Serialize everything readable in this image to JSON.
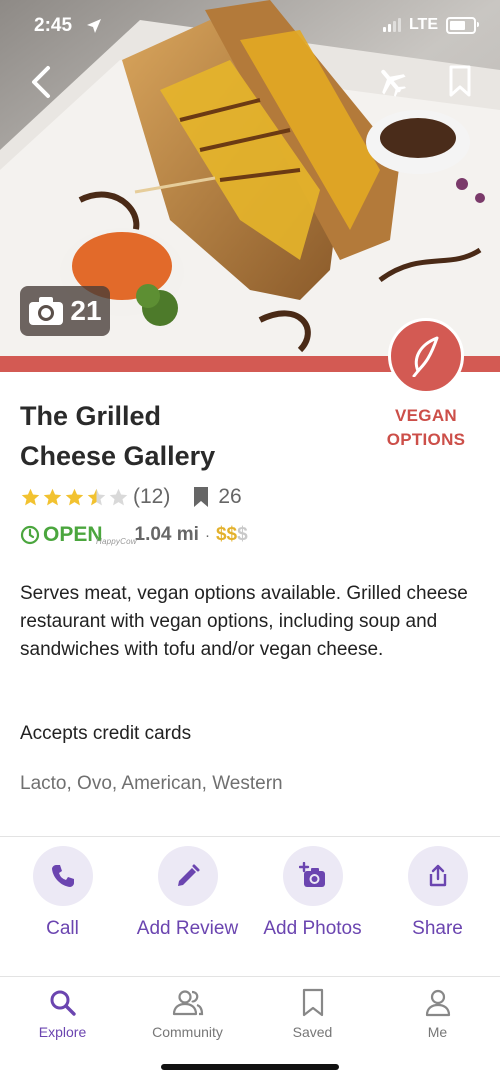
{
  "status_bar": {
    "time": "2:45",
    "network": "LTE"
  },
  "hero": {
    "photo_count": "21",
    "badge_icon": "leaf-icon"
  },
  "restaurant": {
    "name_line1": "The Grilled",
    "name_line2": "Cheese Gallery",
    "category_line1": "VEGAN",
    "category_line2": "OPTIONS",
    "rating": 3.5,
    "rating_max": 5,
    "review_count": "(12)",
    "bookmark_count": "26",
    "open_status": "OPEN",
    "distance": "1.04 mi",
    "separator": "·",
    "price_active": "$$",
    "price_inactive": "$",
    "price_source": "HappyCow",
    "description": "Serves meat, vegan options available. Grilled cheese restaurant with vegan options, including soup and sandwiches with tofu and/or vegan cheese.",
    "payment": "Accepts credit cards",
    "tags": "Lacto, Ovo, American, Western"
  },
  "actions": [
    {
      "label": "Call",
      "icon": "phone-icon"
    },
    {
      "label": "Add Review",
      "icon": "pencil-icon"
    },
    {
      "label": "Add Photos",
      "icon": "camera-plus-icon"
    },
    {
      "label": "Share",
      "icon": "share-icon"
    }
  ],
  "tabs": [
    {
      "label": "Explore",
      "icon": "search-icon",
      "active": true
    },
    {
      "label": "Community",
      "icon": "people-icon",
      "active": false
    },
    {
      "label": "Saved",
      "icon": "bookmark-icon",
      "active": false
    },
    {
      "label": "Me",
      "icon": "person-icon",
      "active": false
    }
  ],
  "colors": {
    "brand_purple": "#6b45b0",
    "vegan_red": "#d35a53",
    "open_green": "#4ba63e",
    "star_gold": "#f2c230",
    "price_gold": "#e3b12c"
  }
}
